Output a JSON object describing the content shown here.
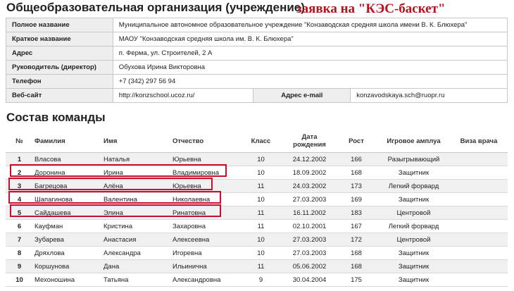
{
  "header": {
    "title": "Общеобразовательная организация (учреждение)",
    "stamp": "заявка на \"КЭС-баскет\""
  },
  "org": {
    "full_name_label": "Полное название",
    "full_name": "Муниципальное автономное образовательное учреждение \"Конзаводская средняя школа имени В. К. Блюхера\"",
    "short_name_label": "Краткое название",
    "short_name": "МАОУ \"Конзаводская средняя школа им. В. К. Блюхера\"",
    "address_label": "Адрес",
    "address": "п. Ферма, ул. Строителей, 2 А",
    "director_label": "Руководитель (директор)",
    "director": "Обухова Ирина Викторовна",
    "phone_label": "Телефон",
    "phone": "+7 (342) 297 56 94",
    "website_label": "Веб-сайт",
    "website": "http://konzschool.ucoz.ru/",
    "email_label": "Адрес e-mail",
    "email": "konzavodskaya.sch@ruopr.ru"
  },
  "team": {
    "title": "Состав команды",
    "headers": {
      "num": "№",
      "surname": "Фамилия",
      "name": "Имя",
      "patronymic": "Отчество",
      "grade": "Класс",
      "dob_line1": "Дата",
      "dob_line2": "рождения",
      "height": "Рост",
      "role": "Игровое амплуа",
      "visa": "Виза врача"
    },
    "rows": [
      {
        "num": "1",
        "surname": "Власова",
        "name": "Наталья",
        "patronymic": "Юрьевна",
        "grade": "10",
        "dob": "24.12.2002",
        "height": "166",
        "role": "Разыгрывающий",
        "visa": ""
      },
      {
        "num": "2",
        "surname": "Доронина",
        "name": "Ирина",
        "patronymic": "Владимировна",
        "grade": "10",
        "dob": "18.09.2002",
        "height": "168",
        "role": "Защитник",
        "visa": ""
      },
      {
        "num": "3",
        "surname": "Багрецова",
        "name": "Алёна",
        "patronymic": "Юрьевна",
        "grade": "11",
        "dob": "24.03.2002",
        "height": "173",
        "role": "Легкий форвард",
        "visa": ""
      },
      {
        "num": "4",
        "surname": "Шапагинова",
        "name": "Валентина",
        "patronymic": "Николаевна",
        "grade": "10",
        "dob": "27.03.2003",
        "height": "169",
        "role": "Защитник",
        "visa": ""
      },
      {
        "num": "5",
        "surname": "Сайдашева",
        "name": "Элина",
        "patronymic": "Ринатовна",
        "grade": "11",
        "dob": "16.11.2002",
        "height": "183",
        "role": "Центровой",
        "visa": ""
      },
      {
        "num": "6",
        "surname": "Кауфман",
        "name": "Кристина",
        "patronymic": "Захаровна",
        "grade": "11",
        "dob": "02.10.2001",
        "height": "167",
        "role": "Легкий форвард",
        "visa": ""
      },
      {
        "num": "7",
        "surname": "Зубарева",
        "name": "Анастасия",
        "patronymic": "Алексеевна",
        "grade": "10",
        "dob": "27.03.2003",
        "height": "172",
        "role": "Центровой",
        "visa": ""
      },
      {
        "num": "8",
        "surname": "Дряхлова",
        "name": "Александра",
        "patronymic": "Игоревна",
        "grade": "10",
        "dob": "27.03.2003",
        "height": "168",
        "role": "Защитник",
        "visa": ""
      },
      {
        "num": "9",
        "surname": "Коршунова",
        "name": "Дана",
        "patronymic": "Ильинична",
        "grade": "11",
        "dob": "05.06.2002",
        "height": "168",
        "role": "Защитник",
        "visa": ""
      },
      {
        "num": "10",
        "surname": "Мехоношина",
        "name": "Татьяна",
        "patronymic": "Александровна",
        "grade": "9",
        "dob": "30.04.2004",
        "height": "175",
        "role": "Защитник",
        "visa": ""
      }
    ]
  },
  "colors": {
    "highlight": "#c8102e",
    "stamp": "#b8111c",
    "label_bg": "#eeeeee",
    "stripe_bg": "#f0f0f0"
  }
}
